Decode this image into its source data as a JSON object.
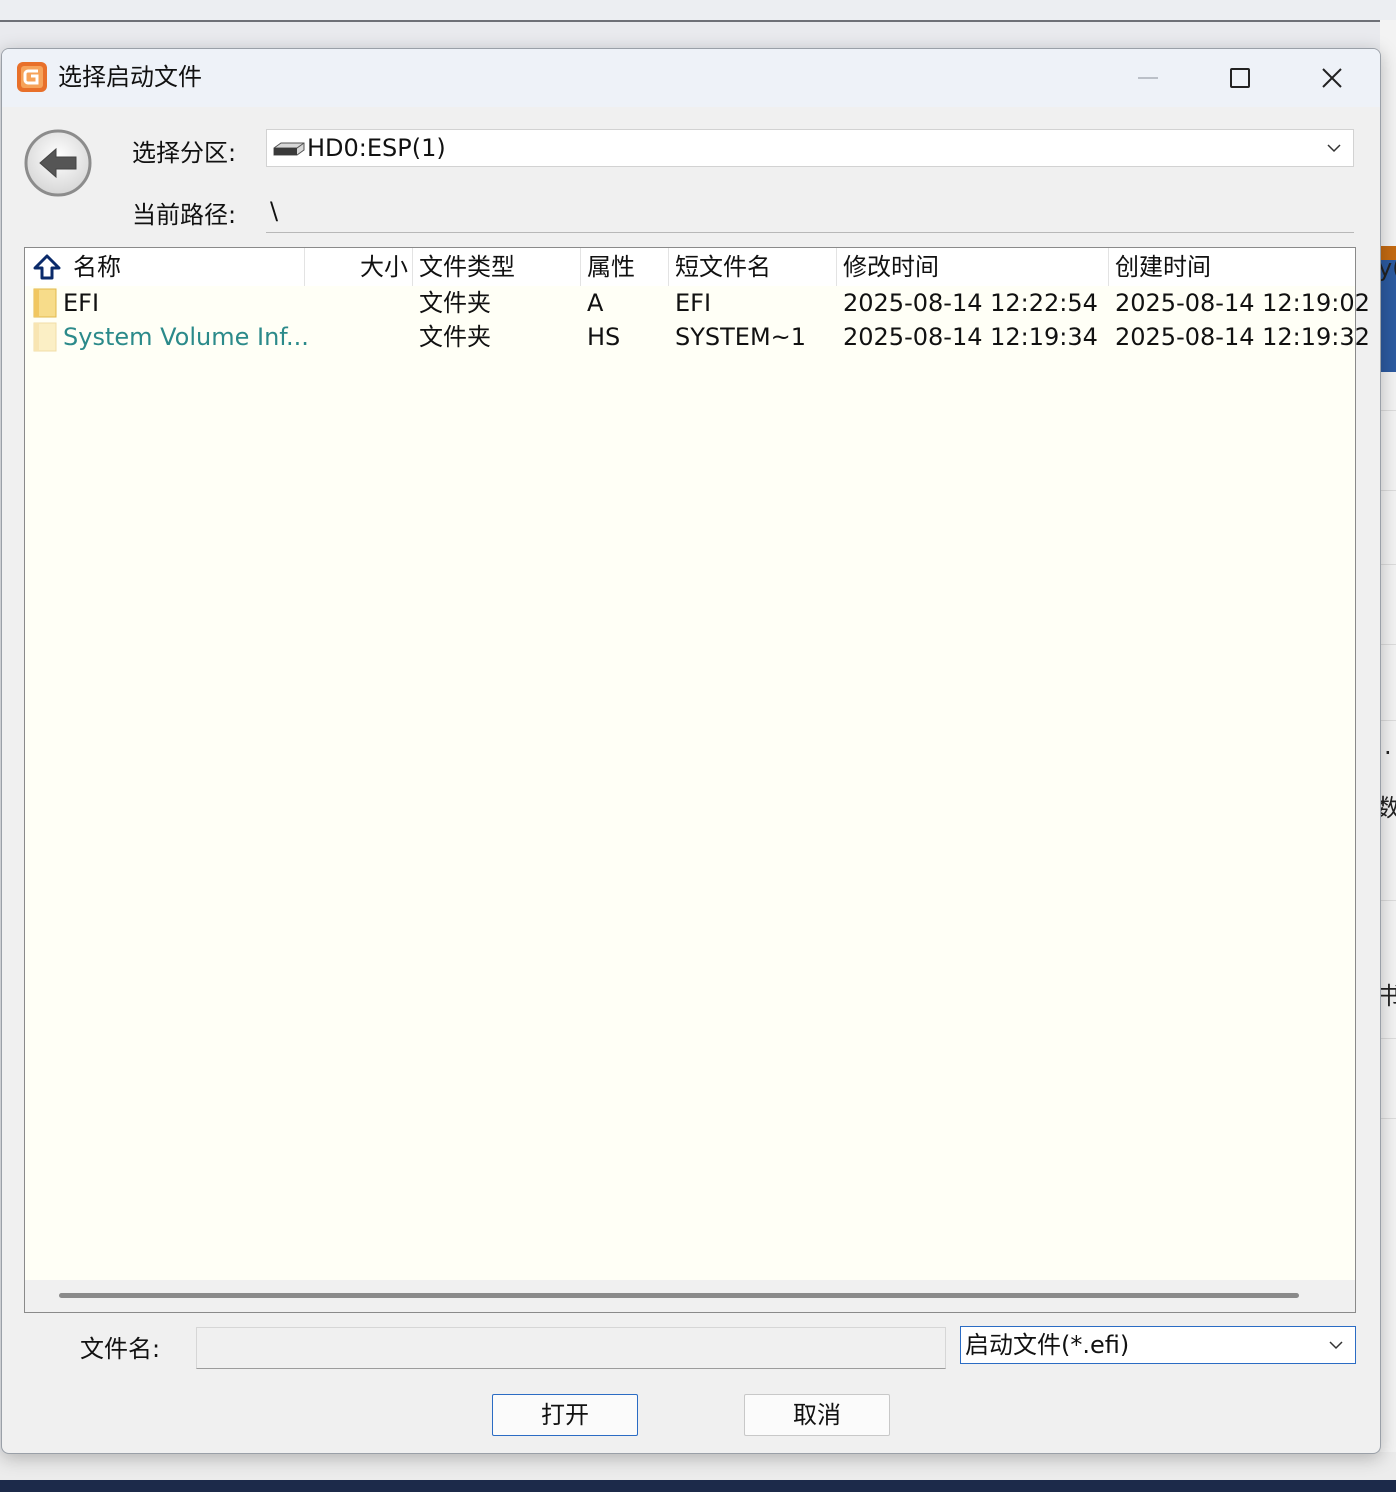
{
  "dialog": {
    "title": "选择启动文件",
    "partition_label": "选择分区:",
    "partition_value": "HD0:ESP(1)",
    "path_label": "当前路径:",
    "path_value": "\\"
  },
  "columns": [
    "名称",
    "大小",
    "文件类型",
    "属性",
    "短文件名",
    "修改时间",
    "创建时间"
  ],
  "files": [
    {
      "name": "EFI",
      "size": "",
      "type": "文件夹",
      "attr": "A",
      "short_name": "EFI",
      "modified": "2025-08-14 12:22:54",
      "created": "2025-08-14 12:19:02"
    },
    {
      "name": "System Volume Inf...",
      "size": "",
      "type": "文件夹",
      "attr": "HS",
      "short_name": "SYSTEM~1",
      "modified": "2025-08-14 12:19:34",
      "created": "2025-08-14 12:19:32"
    }
  ],
  "footer": {
    "filename_label": "文件名:",
    "filename_value": "",
    "filter_value": "启动文件(*.efi)",
    "open_label": "打开",
    "cancel_label": "取消"
  },
  "background": {
    "edge_fragments": [
      "y(",
      ".",
      "数)",
      "书"
    ]
  },
  "colors": {
    "list_bg": "#fffff6",
    "hidden_item_text": "#2b8a8a",
    "focus_border": "#2b6cc4",
    "app_icon": "#e8702a"
  },
  "icons": [
    "app-logo-icon",
    "minimize-icon",
    "maximize-icon",
    "close-icon",
    "back-arrow-icon",
    "drive-icon",
    "chevron-down-icon",
    "up-folder-icon",
    "folder-icon"
  ]
}
